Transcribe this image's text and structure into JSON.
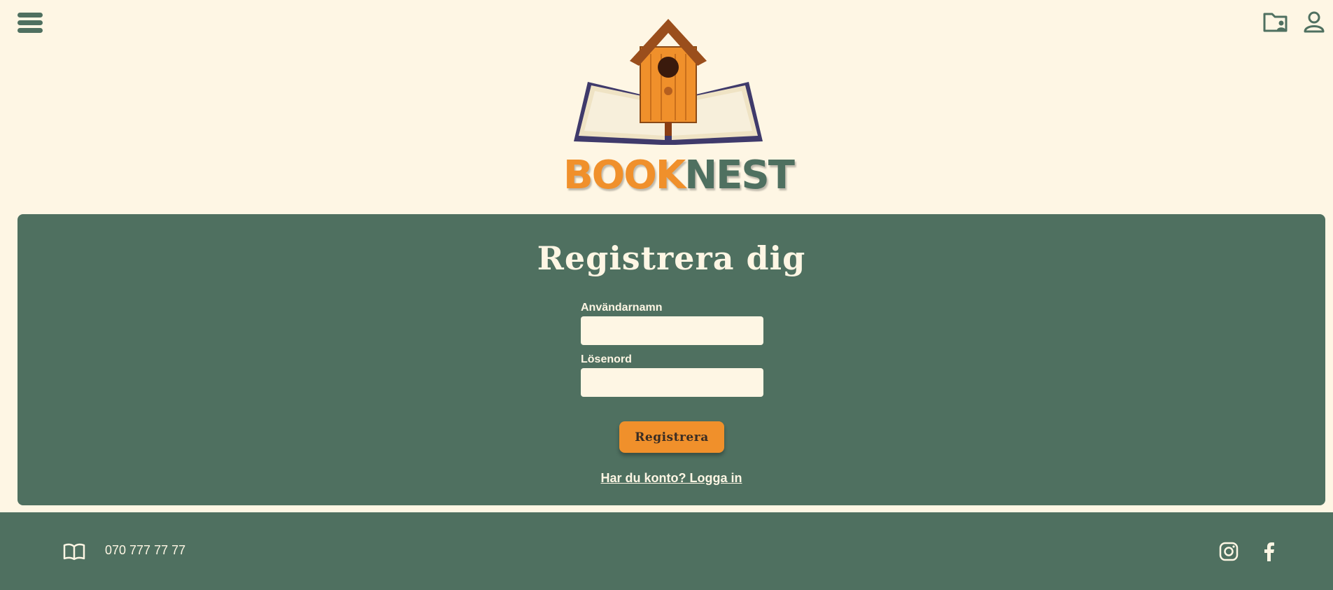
{
  "header": {
    "logo_part1": "BOOK",
    "logo_part2": "NEST"
  },
  "form": {
    "title": "Registrera dig",
    "username_label": "Användarnamn",
    "username_value": "",
    "password_label": "Lösenord",
    "password_value": "",
    "submit_label": "Registrera",
    "login_link": "Har du konto? Logga in"
  },
  "footer": {
    "phone": "070 777 77 77"
  },
  "icons": {
    "menu": "hamburger-icon",
    "folder": "folder-user-icon",
    "user": "user-icon",
    "book": "book-icon",
    "instagram": "instagram-icon",
    "facebook": "facebook-icon"
  },
  "colors": {
    "background": "#fef6e4",
    "green": "#4f7060",
    "orange": "#f0902b"
  }
}
